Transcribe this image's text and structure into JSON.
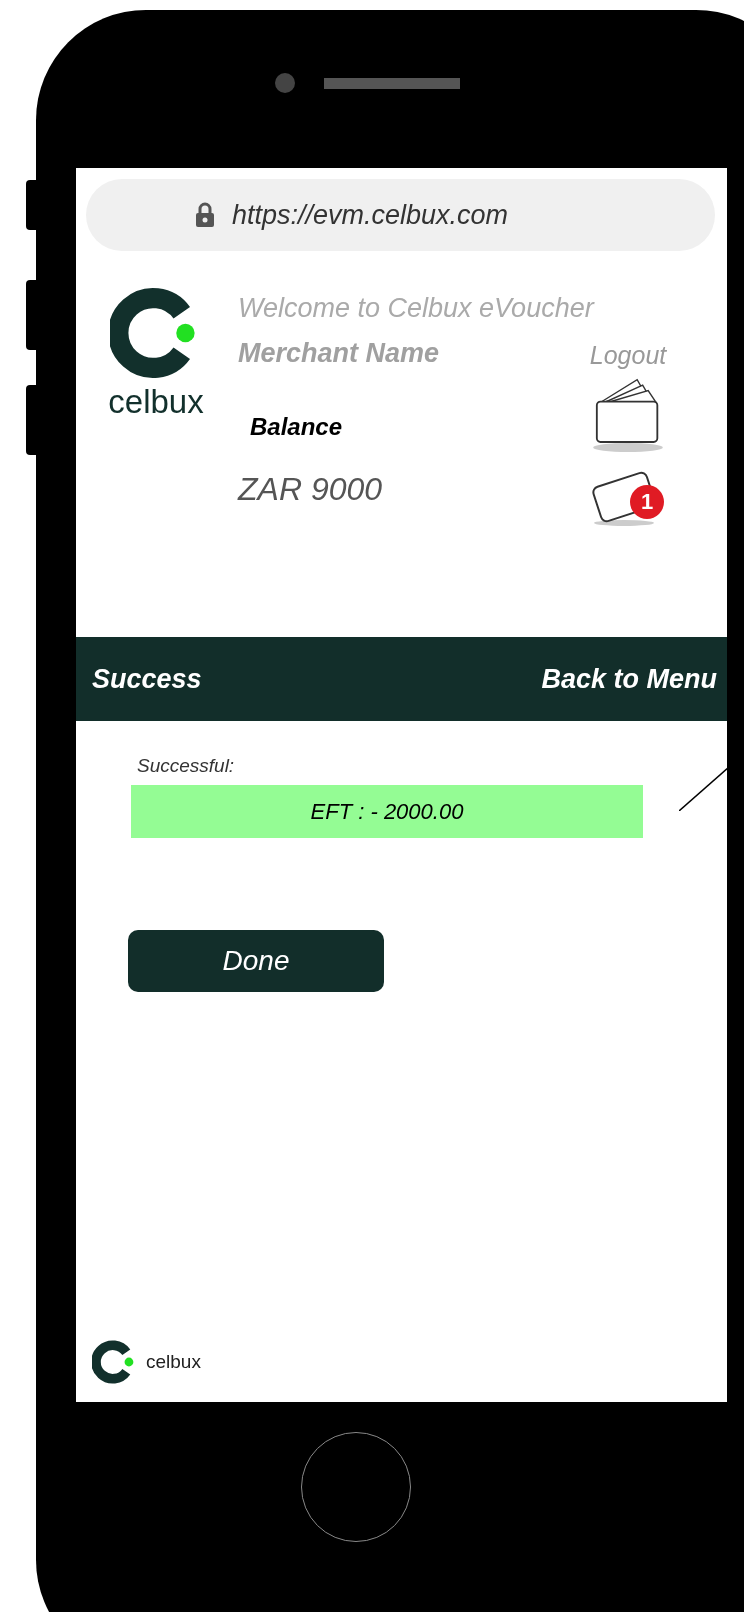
{
  "browser": {
    "url": "https://evm.celbux.com"
  },
  "header": {
    "logo_text": "celbux",
    "welcome": "Welcome to Celbux eVoucher",
    "merchant_name": "Merchant Name",
    "logout": "Logout",
    "balance_label": "Balance",
    "balance": "ZAR 9000",
    "notification_count": "1"
  },
  "title_bar": {
    "title": "Success",
    "back_link": "Back to Menu"
  },
  "result": {
    "label": "Successful:",
    "message": "EFT : - 2000.00"
  },
  "done_button": "Done",
  "footer": {
    "logo_text": "celbux"
  }
}
